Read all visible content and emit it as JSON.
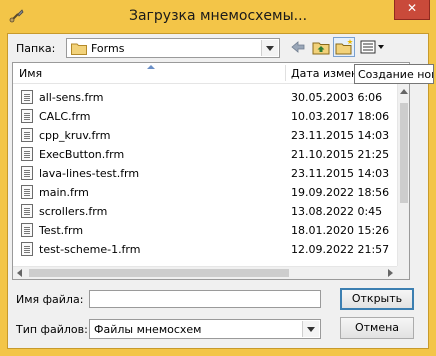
{
  "window": {
    "title": "Загрузка мнемосхемы...",
    "close_glyph": "✕"
  },
  "lookin": {
    "label": "Папка:",
    "folder": "Forms"
  },
  "toolbar": {
    "icons": [
      "back-arrow-icon",
      "up-folder-icon",
      "new-folder-icon",
      "view-menu-icon"
    ]
  },
  "tooltip": "Создание новой папки",
  "list": {
    "columns": [
      "Имя",
      "Дата изменения"
    ],
    "files": [
      {
        "name": "all-sens.frm",
        "date": "30.05.2003 6:06"
      },
      {
        "name": "CALC.frm",
        "date": "10.03.2017 18:06"
      },
      {
        "name": "cpp_kruv.frm",
        "date": "23.11.2015 14:03"
      },
      {
        "name": "ExecButton.frm",
        "date": "21.10.2015 21:25"
      },
      {
        "name": "lava-lines-test.frm",
        "date": "23.11.2015 14:03"
      },
      {
        "name": "main.frm",
        "date": "19.09.2022 18:56"
      },
      {
        "name": "scrollers.frm",
        "date": "13.08.2022 0:45"
      },
      {
        "name": "Test.frm",
        "date": "18.01.2020 15:26"
      },
      {
        "name": "test-scheme-1.frm",
        "date": "12.09.2022 21:57"
      }
    ]
  },
  "filename": {
    "label": "Имя файла:",
    "value": ""
  },
  "filetype": {
    "label": "Тип файлов:",
    "value": "Файлы мнемосхем"
  },
  "buttons": {
    "open": "Открыть",
    "cancel": "Отмена"
  }
}
